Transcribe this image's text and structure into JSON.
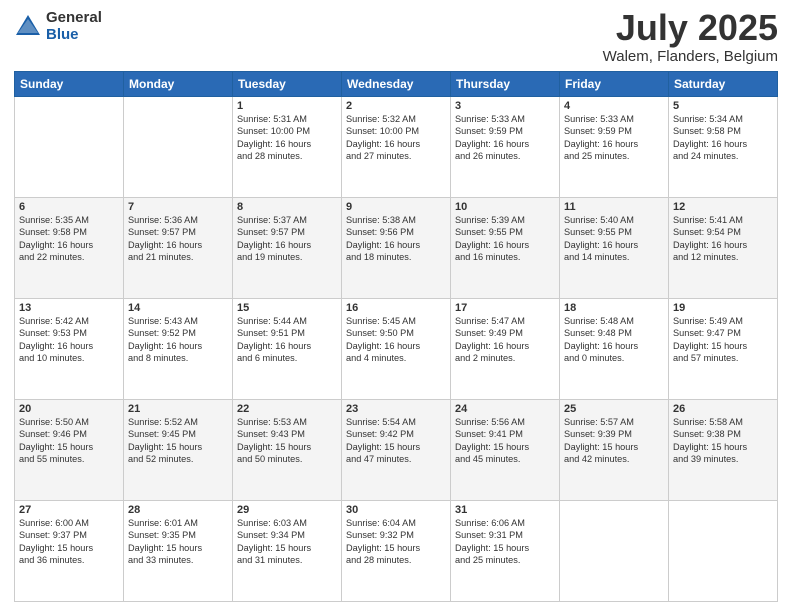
{
  "header": {
    "logo_general": "General",
    "logo_blue": "Blue",
    "month": "July 2025",
    "location": "Walem, Flanders, Belgium"
  },
  "days_of_week": [
    "Sunday",
    "Monday",
    "Tuesday",
    "Wednesday",
    "Thursday",
    "Friday",
    "Saturday"
  ],
  "weeks": [
    [
      {
        "day": "",
        "info": ""
      },
      {
        "day": "",
        "info": ""
      },
      {
        "day": "1",
        "info": "Sunrise: 5:31 AM\nSunset: 10:00 PM\nDaylight: 16 hours\nand 28 minutes."
      },
      {
        "day": "2",
        "info": "Sunrise: 5:32 AM\nSunset: 10:00 PM\nDaylight: 16 hours\nand 27 minutes."
      },
      {
        "day": "3",
        "info": "Sunrise: 5:33 AM\nSunset: 9:59 PM\nDaylight: 16 hours\nand 26 minutes."
      },
      {
        "day": "4",
        "info": "Sunrise: 5:33 AM\nSunset: 9:59 PM\nDaylight: 16 hours\nand 25 minutes."
      },
      {
        "day": "5",
        "info": "Sunrise: 5:34 AM\nSunset: 9:58 PM\nDaylight: 16 hours\nand 24 minutes."
      }
    ],
    [
      {
        "day": "6",
        "info": "Sunrise: 5:35 AM\nSunset: 9:58 PM\nDaylight: 16 hours\nand 22 minutes."
      },
      {
        "day": "7",
        "info": "Sunrise: 5:36 AM\nSunset: 9:57 PM\nDaylight: 16 hours\nand 21 minutes."
      },
      {
        "day": "8",
        "info": "Sunrise: 5:37 AM\nSunset: 9:57 PM\nDaylight: 16 hours\nand 19 minutes."
      },
      {
        "day": "9",
        "info": "Sunrise: 5:38 AM\nSunset: 9:56 PM\nDaylight: 16 hours\nand 18 minutes."
      },
      {
        "day": "10",
        "info": "Sunrise: 5:39 AM\nSunset: 9:55 PM\nDaylight: 16 hours\nand 16 minutes."
      },
      {
        "day": "11",
        "info": "Sunrise: 5:40 AM\nSunset: 9:55 PM\nDaylight: 16 hours\nand 14 minutes."
      },
      {
        "day": "12",
        "info": "Sunrise: 5:41 AM\nSunset: 9:54 PM\nDaylight: 16 hours\nand 12 minutes."
      }
    ],
    [
      {
        "day": "13",
        "info": "Sunrise: 5:42 AM\nSunset: 9:53 PM\nDaylight: 16 hours\nand 10 minutes."
      },
      {
        "day": "14",
        "info": "Sunrise: 5:43 AM\nSunset: 9:52 PM\nDaylight: 16 hours\nand 8 minutes."
      },
      {
        "day": "15",
        "info": "Sunrise: 5:44 AM\nSunset: 9:51 PM\nDaylight: 16 hours\nand 6 minutes."
      },
      {
        "day": "16",
        "info": "Sunrise: 5:45 AM\nSunset: 9:50 PM\nDaylight: 16 hours\nand 4 minutes."
      },
      {
        "day": "17",
        "info": "Sunrise: 5:47 AM\nSunset: 9:49 PM\nDaylight: 16 hours\nand 2 minutes."
      },
      {
        "day": "18",
        "info": "Sunrise: 5:48 AM\nSunset: 9:48 PM\nDaylight: 16 hours\nand 0 minutes."
      },
      {
        "day": "19",
        "info": "Sunrise: 5:49 AM\nSunset: 9:47 PM\nDaylight: 15 hours\nand 57 minutes."
      }
    ],
    [
      {
        "day": "20",
        "info": "Sunrise: 5:50 AM\nSunset: 9:46 PM\nDaylight: 15 hours\nand 55 minutes."
      },
      {
        "day": "21",
        "info": "Sunrise: 5:52 AM\nSunset: 9:45 PM\nDaylight: 15 hours\nand 52 minutes."
      },
      {
        "day": "22",
        "info": "Sunrise: 5:53 AM\nSunset: 9:43 PM\nDaylight: 15 hours\nand 50 minutes."
      },
      {
        "day": "23",
        "info": "Sunrise: 5:54 AM\nSunset: 9:42 PM\nDaylight: 15 hours\nand 47 minutes."
      },
      {
        "day": "24",
        "info": "Sunrise: 5:56 AM\nSunset: 9:41 PM\nDaylight: 15 hours\nand 45 minutes."
      },
      {
        "day": "25",
        "info": "Sunrise: 5:57 AM\nSunset: 9:39 PM\nDaylight: 15 hours\nand 42 minutes."
      },
      {
        "day": "26",
        "info": "Sunrise: 5:58 AM\nSunset: 9:38 PM\nDaylight: 15 hours\nand 39 minutes."
      }
    ],
    [
      {
        "day": "27",
        "info": "Sunrise: 6:00 AM\nSunset: 9:37 PM\nDaylight: 15 hours\nand 36 minutes."
      },
      {
        "day": "28",
        "info": "Sunrise: 6:01 AM\nSunset: 9:35 PM\nDaylight: 15 hours\nand 33 minutes."
      },
      {
        "day": "29",
        "info": "Sunrise: 6:03 AM\nSunset: 9:34 PM\nDaylight: 15 hours\nand 31 minutes."
      },
      {
        "day": "30",
        "info": "Sunrise: 6:04 AM\nSunset: 9:32 PM\nDaylight: 15 hours\nand 28 minutes."
      },
      {
        "day": "31",
        "info": "Sunrise: 6:06 AM\nSunset: 9:31 PM\nDaylight: 15 hours\nand 25 minutes."
      },
      {
        "day": "",
        "info": ""
      },
      {
        "day": "",
        "info": ""
      }
    ]
  ]
}
